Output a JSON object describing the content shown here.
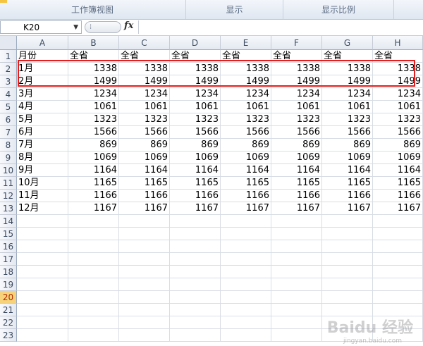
{
  "ribbon": {
    "groups": [
      "工作簿视图",
      "显示",
      "显示比例"
    ]
  },
  "formula_bar": {
    "name_box": "K20",
    "fx_label": "fx",
    "formula": ""
  },
  "columns": [
    "A",
    "B",
    "C",
    "D",
    "E",
    "F",
    "G",
    "H"
  ],
  "row_numbers": [
    "1",
    "2",
    "3",
    "4",
    "5",
    "6",
    "7",
    "8",
    "9",
    "10",
    "11",
    "12",
    "13",
    "14",
    "15",
    "16",
    "17",
    "18",
    "19",
    "20",
    "21",
    "22",
    "23"
  ],
  "selected_row": "20",
  "rows": [
    [
      "月份",
      "全省",
      "全省",
      "全省",
      "全省",
      "全省",
      "全省",
      "全省"
    ],
    [
      "1月",
      "1338",
      "1338",
      "1338",
      "1338",
      "1338",
      "1338",
      "1338"
    ],
    [
      "2月",
      "1499",
      "1499",
      "1499",
      "1499",
      "1499",
      "1499",
      "1499"
    ],
    [
      "3月",
      "1234",
      "1234",
      "1234",
      "1234",
      "1234",
      "1234",
      "1234"
    ],
    [
      "4月",
      "1061",
      "1061",
      "1061",
      "1061",
      "1061",
      "1061",
      "1061"
    ],
    [
      "5月",
      "1323",
      "1323",
      "1323",
      "1323",
      "1323",
      "1323",
      "1323"
    ],
    [
      "6月",
      "1566",
      "1566",
      "1566",
      "1566",
      "1566",
      "1566",
      "1566"
    ],
    [
      "7月",
      "869",
      "869",
      "869",
      "869",
      "869",
      "869",
      "869"
    ],
    [
      "8月",
      "1069",
      "1069",
      "1069",
      "1069",
      "1069",
      "1069",
      "1069"
    ],
    [
      "9月",
      "1164",
      "1164",
      "1164",
      "1164",
      "1164",
      "1164",
      "1164"
    ],
    [
      "10月",
      "1165",
      "1165",
      "1165",
      "1165",
      "1165",
      "1165",
      "1165"
    ],
    [
      "11月",
      "1166",
      "1166",
      "1166",
      "1166",
      "1166",
      "1166",
      "1166"
    ],
    [
      "12月",
      "1167",
      "1167",
      "1167",
      "1167",
      "1167",
      "1167",
      "1167"
    ]
  ],
  "watermark": {
    "logo": "Baidu 经验",
    "url": "jingyan.baidu.com"
  }
}
